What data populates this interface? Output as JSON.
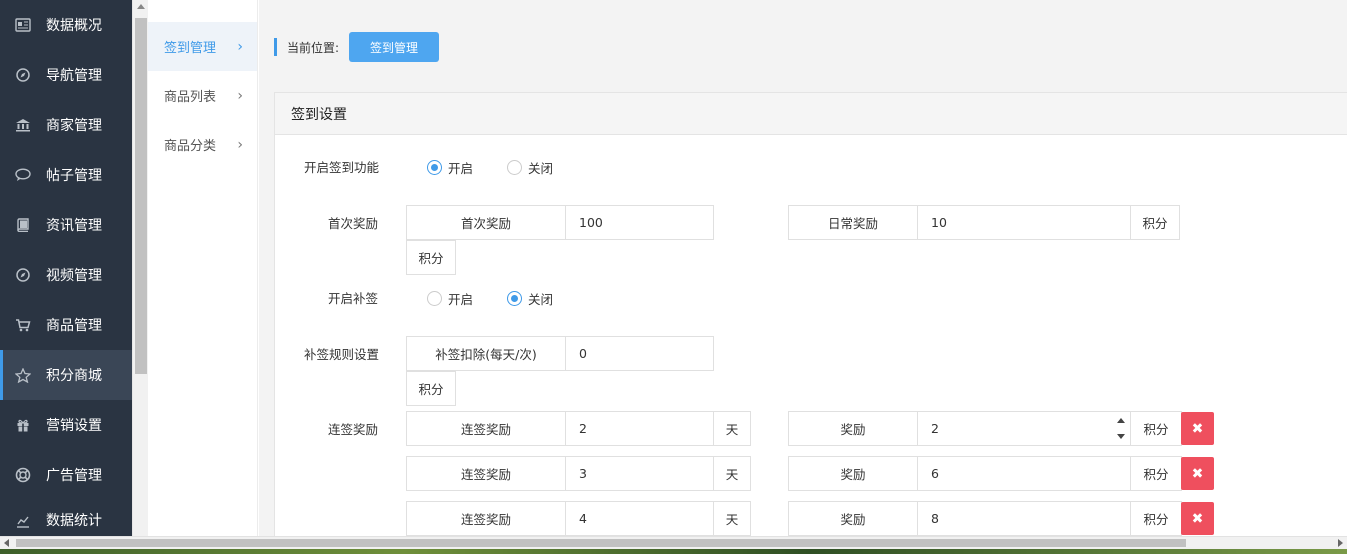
{
  "sidebar": {
    "items": [
      {
        "label": "数据概况",
        "icon": "dashboard-icon"
      },
      {
        "label": "导航管理",
        "icon": "compass-icon"
      },
      {
        "label": "商家管理",
        "icon": "bank-icon"
      },
      {
        "label": "帖子管理",
        "icon": "chat-icon"
      },
      {
        "label": "资讯管理",
        "icon": "book-icon"
      },
      {
        "label": "视频管理",
        "icon": "compass-icon"
      },
      {
        "label": "商品管理",
        "icon": "cart-icon"
      },
      {
        "label": "积分商城",
        "icon": "star-icon",
        "active": true
      },
      {
        "label": "营销设置",
        "icon": "gift-icon"
      },
      {
        "label": "广告管理",
        "icon": "lifebuoy-icon"
      },
      {
        "label": "数据统计",
        "icon": "chart-icon"
      }
    ]
  },
  "subnav": {
    "items": [
      {
        "label": "签到管理",
        "active": true
      },
      {
        "label": "商品列表"
      },
      {
        "label": "商品分类"
      }
    ]
  },
  "breadcrumb": {
    "label": "当前位置:",
    "current": "签到管理"
  },
  "panel": {
    "title": "签到设置",
    "enable_signin": {
      "label": "开启签到功能",
      "options": [
        "开启",
        "关闭"
      ],
      "selected": "开启"
    },
    "first_reward": {
      "label": "首次奖励",
      "addon": "首次奖励",
      "value": "100",
      "unit": "积分"
    },
    "daily_reward": {
      "addon": "日常奖励",
      "value": "10",
      "unit": "积分"
    },
    "enable_makeup": {
      "label": "开启补签",
      "options": [
        "开启",
        "关闭"
      ],
      "selected": "关闭"
    },
    "makeup_rule": {
      "label": "补签规则设置",
      "addon": "补签扣除(每天/次)",
      "value": "0",
      "unit": "积分"
    },
    "streak": {
      "label": "连签奖励",
      "rows": [
        {
          "addon": "连签奖励",
          "days": "2",
          "day_unit": "天",
          "reward_addon": "奖励",
          "reward": "2",
          "reward_unit": "积分",
          "delete": "✖"
        },
        {
          "addon": "连签奖励",
          "days": "3",
          "day_unit": "天",
          "reward_addon": "奖励",
          "reward": "6",
          "reward_unit": "积分",
          "delete": "✖"
        },
        {
          "addon": "连签奖励",
          "days": "4",
          "day_unit": "天",
          "reward_addon": "奖励",
          "reward": "8",
          "reward_unit": "积分",
          "delete": "✖"
        }
      ]
    }
  },
  "colors": {
    "accent": "#3f9ae8",
    "sidebar_bg": "#2a3442",
    "danger": "#ef4f5e"
  }
}
